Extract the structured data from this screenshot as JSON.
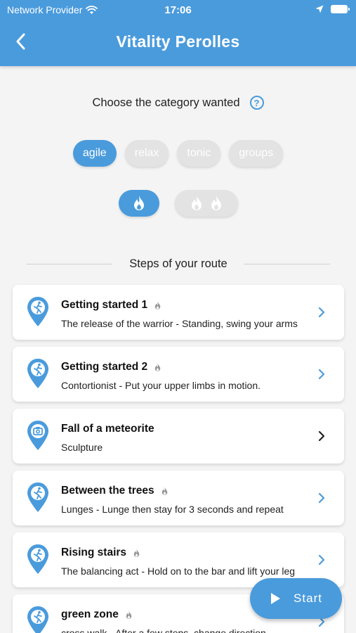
{
  "status": {
    "carrier": "Network Provider",
    "time": "17:06"
  },
  "header": {
    "title": "Vitality Perolles"
  },
  "prompt": {
    "text": "Choose the category wanted",
    "help_icon": "?"
  },
  "categories": [
    {
      "label": "agile",
      "active": true
    },
    {
      "label": "relax",
      "active": false
    },
    {
      "label": "tonic",
      "active": false
    },
    {
      "label": "groups",
      "active": false
    }
  ],
  "levels": [
    {
      "flames": 1,
      "active": true
    },
    {
      "flames": 2,
      "active": false
    }
  ],
  "section": {
    "label": "Steps of your route"
  },
  "steps": [
    {
      "name": "Getting started 1",
      "desc": "The release of the warrior - Standing, swing your arms",
      "icon": "runner",
      "flame": true,
      "chev_color": "#4a9bdc"
    },
    {
      "name": "Getting started 2",
      "desc": "Contortionist - Put your upper limbs in motion.",
      "icon": "runner",
      "flame": true,
      "chev_color": "#4a9bdc"
    },
    {
      "name": "Fall of a meteorite",
      "desc": "Sculpture",
      "icon": "camera",
      "flame": false,
      "chev_color": "#222222"
    },
    {
      "name": "Between the trees",
      "desc": "Lunges - Lunge then stay for 3 seconds and repeat",
      "icon": "runner",
      "flame": true,
      "chev_color": "#4a9bdc"
    },
    {
      "name": "Rising stairs",
      "desc": "The balancing act - Hold on to the bar and lift your leg",
      "icon": "runner",
      "flame": true,
      "chev_color": "#4a9bdc"
    },
    {
      "name": "green zone",
      "desc": "cross walk - After a few steps, change direction",
      "icon": "runner",
      "flame": true,
      "chev_color": "#4a9bdc"
    }
  ],
  "fab": {
    "label": "Start"
  },
  "colors": {
    "accent": "#4a9bdc",
    "chip_inactive": "#e3e3e3"
  }
}
